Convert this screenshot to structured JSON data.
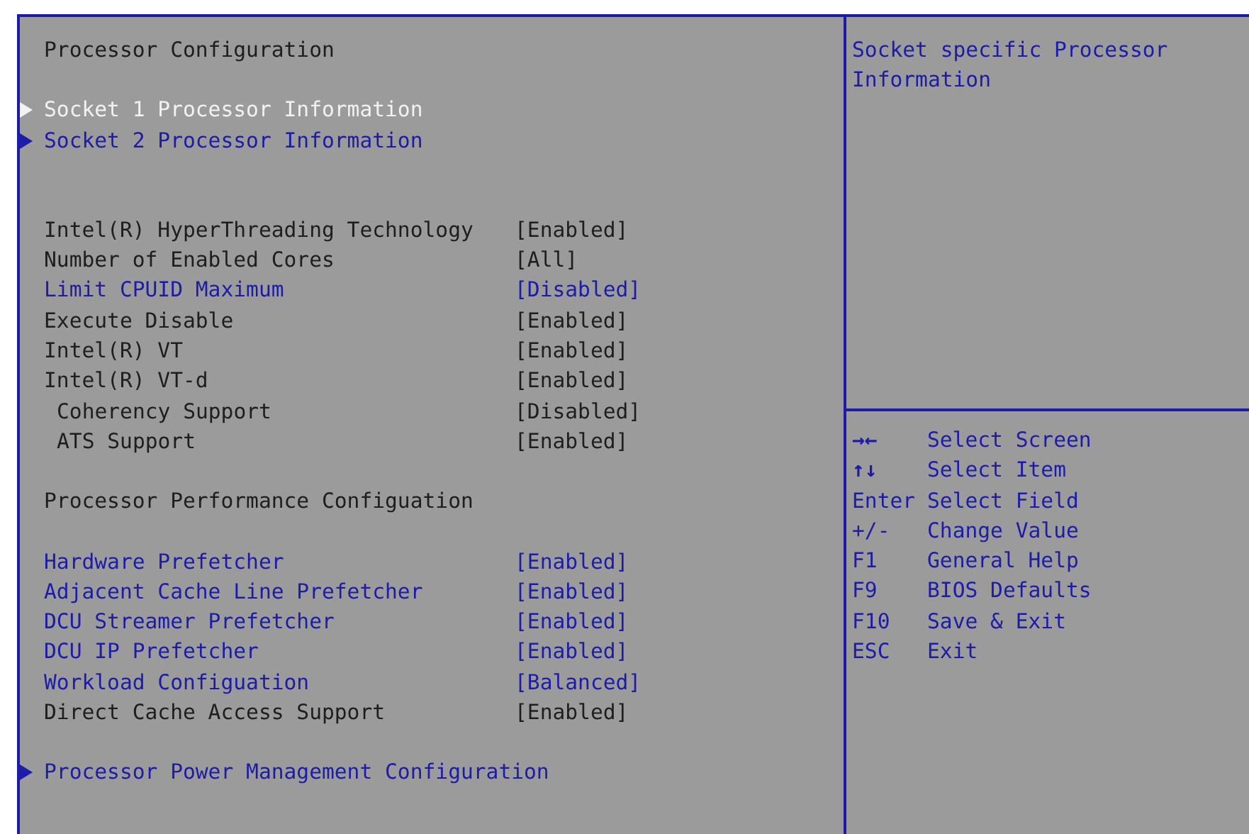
{
  "main_panel": {
    "sections": [
      {
        "kind": "heading",
        "items": [
          {
            "label": "Processor Configuration"
          }
        ]
      },
      {
        "kind": "submenus",
        "items": [
          {
            "label": "Socket 1 Processor Information",
            "selected": true
          },
          {
            "label": "Socket 2 Processor Information",
            "selected": false
          }
        ]
      },
      {
        "kind": "settings",
        "items": [
          {
            "label": "Intel(R) HyperThreading Technology",
            "value": "[Enabled]",
            "configurable": false
          },
          {
            "label": "Number of Enabled Cores",
            "value": "[All]",
            "configurable": false
          },
          {
            "label": "Limit CPUID Maximum",
            "value": "[Disabled]",
            "configurable": true
          },
          {
            "label": "Execute Disable",
            "value": "[Enabled]",
            "configurable": false
          },
          {
            "label": "Intel(R) VT",
            "value": "[Enabled]",
            "configurable": false
          },
          {
            "label": "Intel(R) VT-d",
            "value": "[Enabled]",
            "configurable": false,
            "children": [
              {
                "label": "Coherency Support",
                "value": "[Disabled]",
                "configurable": false
              },
              {
                "label": "ATS Support",
                "value": "[Enabled]",
                "configurable": false
              }
            ]
          }
        ]
      },
      {
        "kind": "heading",
        "items": [
          {
            "label": "Processor Performance Configuation"
          }
        ]
      },
      {
        "kind": "settings",
        "items": [
          {
            "label": "Hardware Prefetcher",
            "value": "[Enabled]",
            "configurable": true
          },
          {
            "label": "Adjacent Cache Line Prefetcher",
            "value": "[Enabled]",
            "configurable": true
          },
          {
            "label": "DCU Streamer Prefetcher",
            "value": "[Enabled]",
            "configurable": true
          },
          {
            "label": "DCU IP Prefetcher",
            "value": "[Enabled]",
            "configurable": true
          },
          {
            "label": "Workload Configuation",
            "value": "[Balanced]",
            "configurable": true
          },
          {
            "label": "Direct Cache Access Support",
            "value": "[Enabled]",
            "configurable": false
          }
        ]
      },
      {
        "kind": "submenus",
        "items": [
          {
            "label": "Processor Power Management Configuration",
            "selected": false
          }
        ]
      }
    ]
  },
  "help_panel": {
    "description": "Socket specific Processor Information",
    "keys": [
      {
        "key": "→←",
        "action": "Select Screen"
      },
      {
        "key": "↑↓",
        "action": "Select Item"
      },
      {
        "key": "Enter",
        "action": "Select Field"
      },
      {
        "key": "+/-",
        "action": "Change Value"
      },
      {
        "key": "F1",
        "action": "General Help"
      },
      {
        "key": "F9",
        "action": "BIOS Defaults"
      },
      {
        "key": "F10",
        "action": "Save & Exit"
      },
      {
        "key": "ESC",
        "action": "Exit"
      }
    ]
  }
}
